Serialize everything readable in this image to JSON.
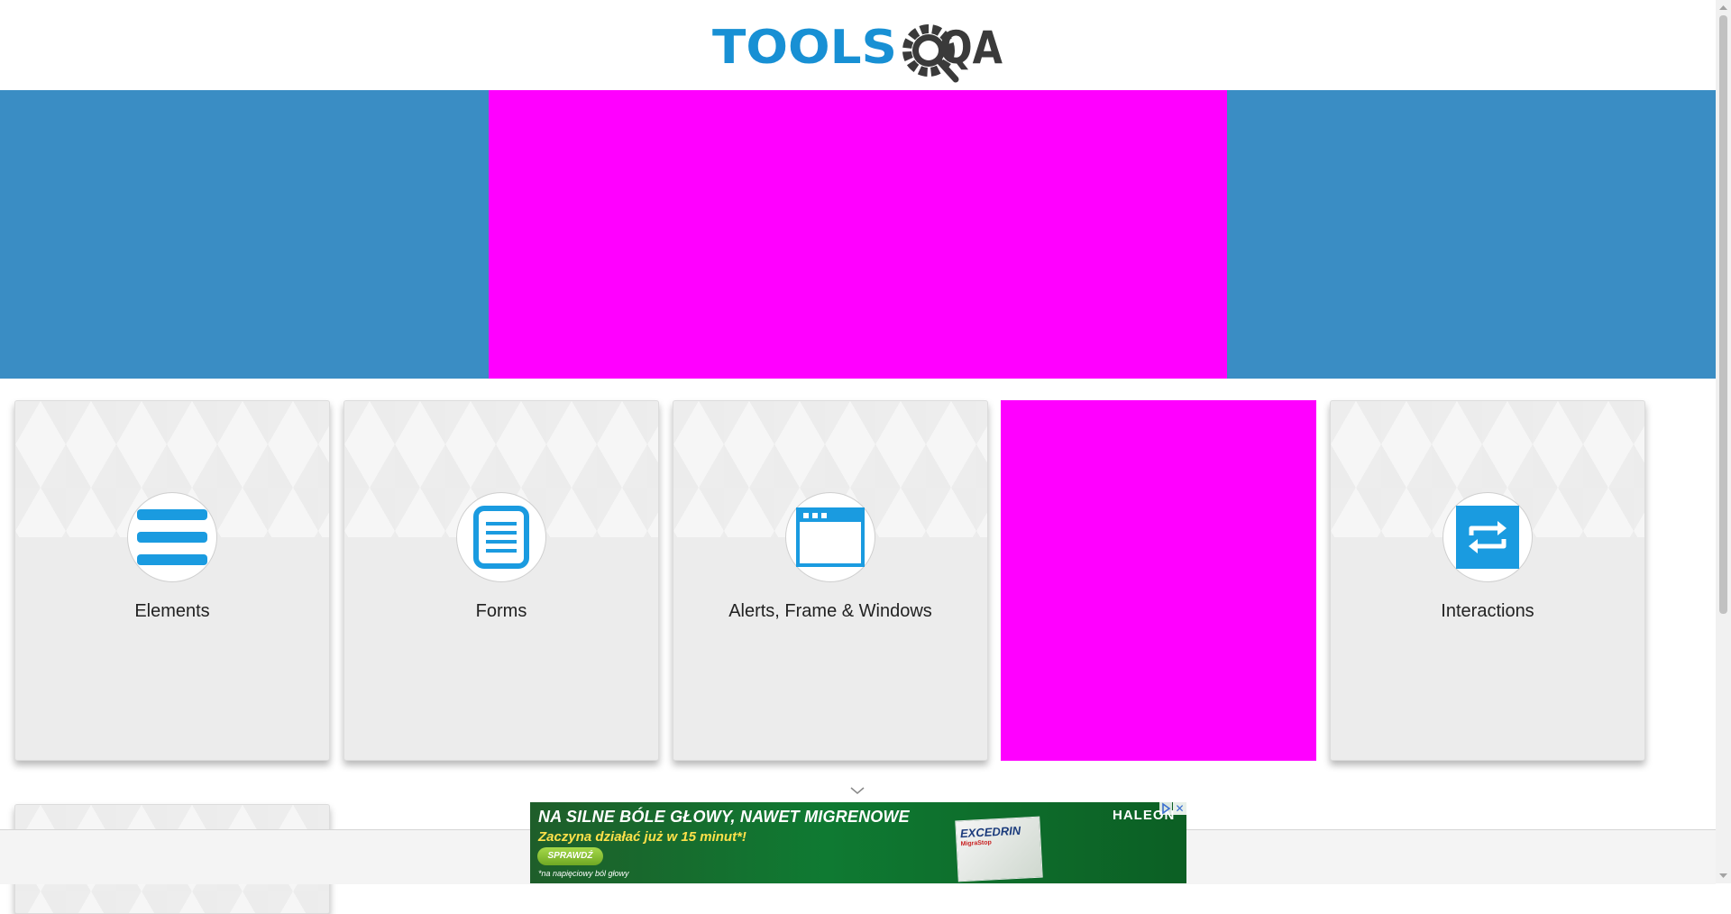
{
  "header": {
    "logo_text_tools": "TOOLS",
    "logo_text_qa": "QA"
  },
  "cards": [
    {
      "title": "Elements",
      "icon": "elements-list-icon"
    },
    {
      "title": "Forms",
      "icon": "forms-document-icon"
    },
    {
      "title": "Alerts, Frame & Windows",
      "icon": "browser-window-icon"
    },
    {
      "title": "Interactions",
      "icon": "interactions-arrows-icon"
    }
  ],
  "ad_bottom": {
    "headline": "NA SILNE  BÓLE GŁOWY, NAWET MIGRENOWE",
    "subline": "Zaczyna działać już w 15 minut*!",
    "button": "SPRAWDŹ",
    "footnote": "*na napięciowy ból głowy",
    "product_name": "EXCEDRIN",
    "product_sub": "MigraStop",
    "brand": "HALEON",
    "close_symbol": "✕"
  },
  "colors": {
    "brand_blue": "#1890d4",
    "logo_dark": "#3a3a3a",
    "banner_blue": "#3a8dc4",
    "placeholder_magenta": "#ff00ff",
    "card_bg": "#ececec",
    "icon_blue": "#1a9be0"
  }
}
